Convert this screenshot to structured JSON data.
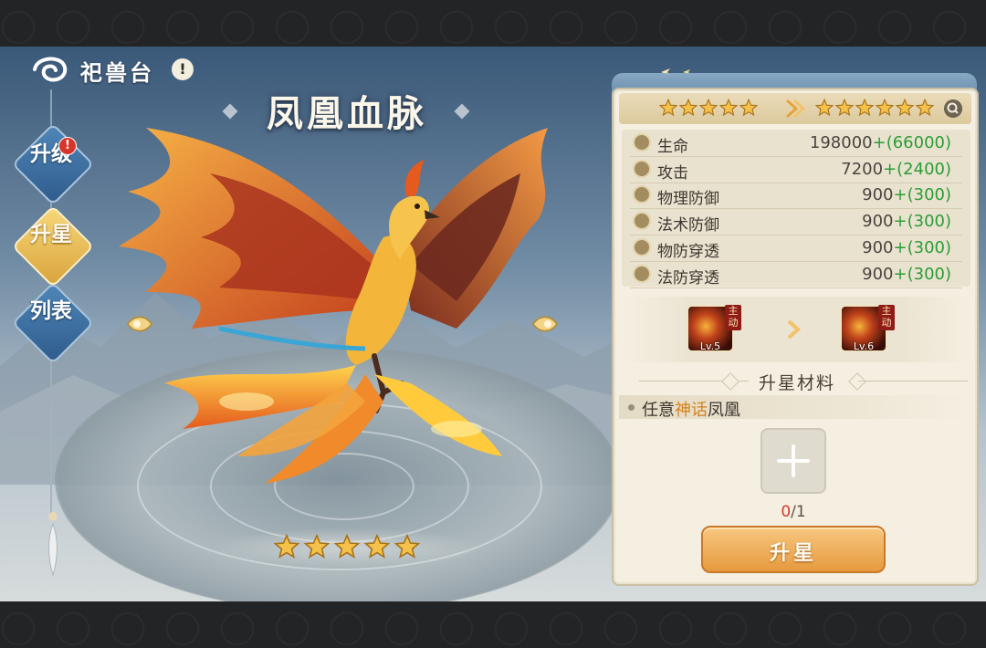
{
  "header": {
    "title": "祀兽台",
    "info_label": "!"
  },
  "side_menu": [
    {
      "label": "升级",
      "badge": "!"
    },
    {
      "label": "升星",
      "active": true
    },
    {
      "label": "列表"
    }
  ],
  "beast": {
    "name": "凤凰血脉",
    "star_count": 5
  },
  "star_compare": {
    "current_stars": 5,
    "next_stars": 6
  },
  "stats": [
    {
      "label": "生命",
      "value": "198000",
      "bonus": "+(66000)",
      "icon": "heart-icon"
    },
    {
      "label": "攻击",
      "value": "7200",
      "bonus": "+(2400)",
      "icon": "sword-icon"
    },
    {
      "label": "物理防御",
      "value": "900",
      "bonus": "+(300)",
      "icon": "shield-icon"
    },
    {
      "label": "法术防御",
      "value": "900",
      "bonus": "+(300)",
      "icon": "magic-shield-icon"
    },
    {
      "label": "物防穿透",
      "value": "900",
      "bonus": "+(300)",
      "icon": "pierce-icon"
    },
    {
      "label": "法防穿透",
      "value": "900",
      "bonus": "+(300)",
      "icon": "magic-pierce-icon"
    }
  ],
  "skills": {
    "current": {
      "tag": "主动",
      "level": "Lv.5"
    },
    "next": {
      "tag": "主动",
      "level": "Lv.6"
    }
  },
  "materials": {
    "title": "升星材料",
    "requirement_prefix": "任意",
    "requirement_highlight": "神话",
    "requirement_suffix": "凤凰",
    "progress_current": "0",
    "progress_total": "/1"
  },
  "upgrade_button": "升星",
  "colors": {
    "bonus_green": "#2a9d36",
    "highlight_orange": "#d4821f",
    "button_orange": "#e69a3e"
  }
}
